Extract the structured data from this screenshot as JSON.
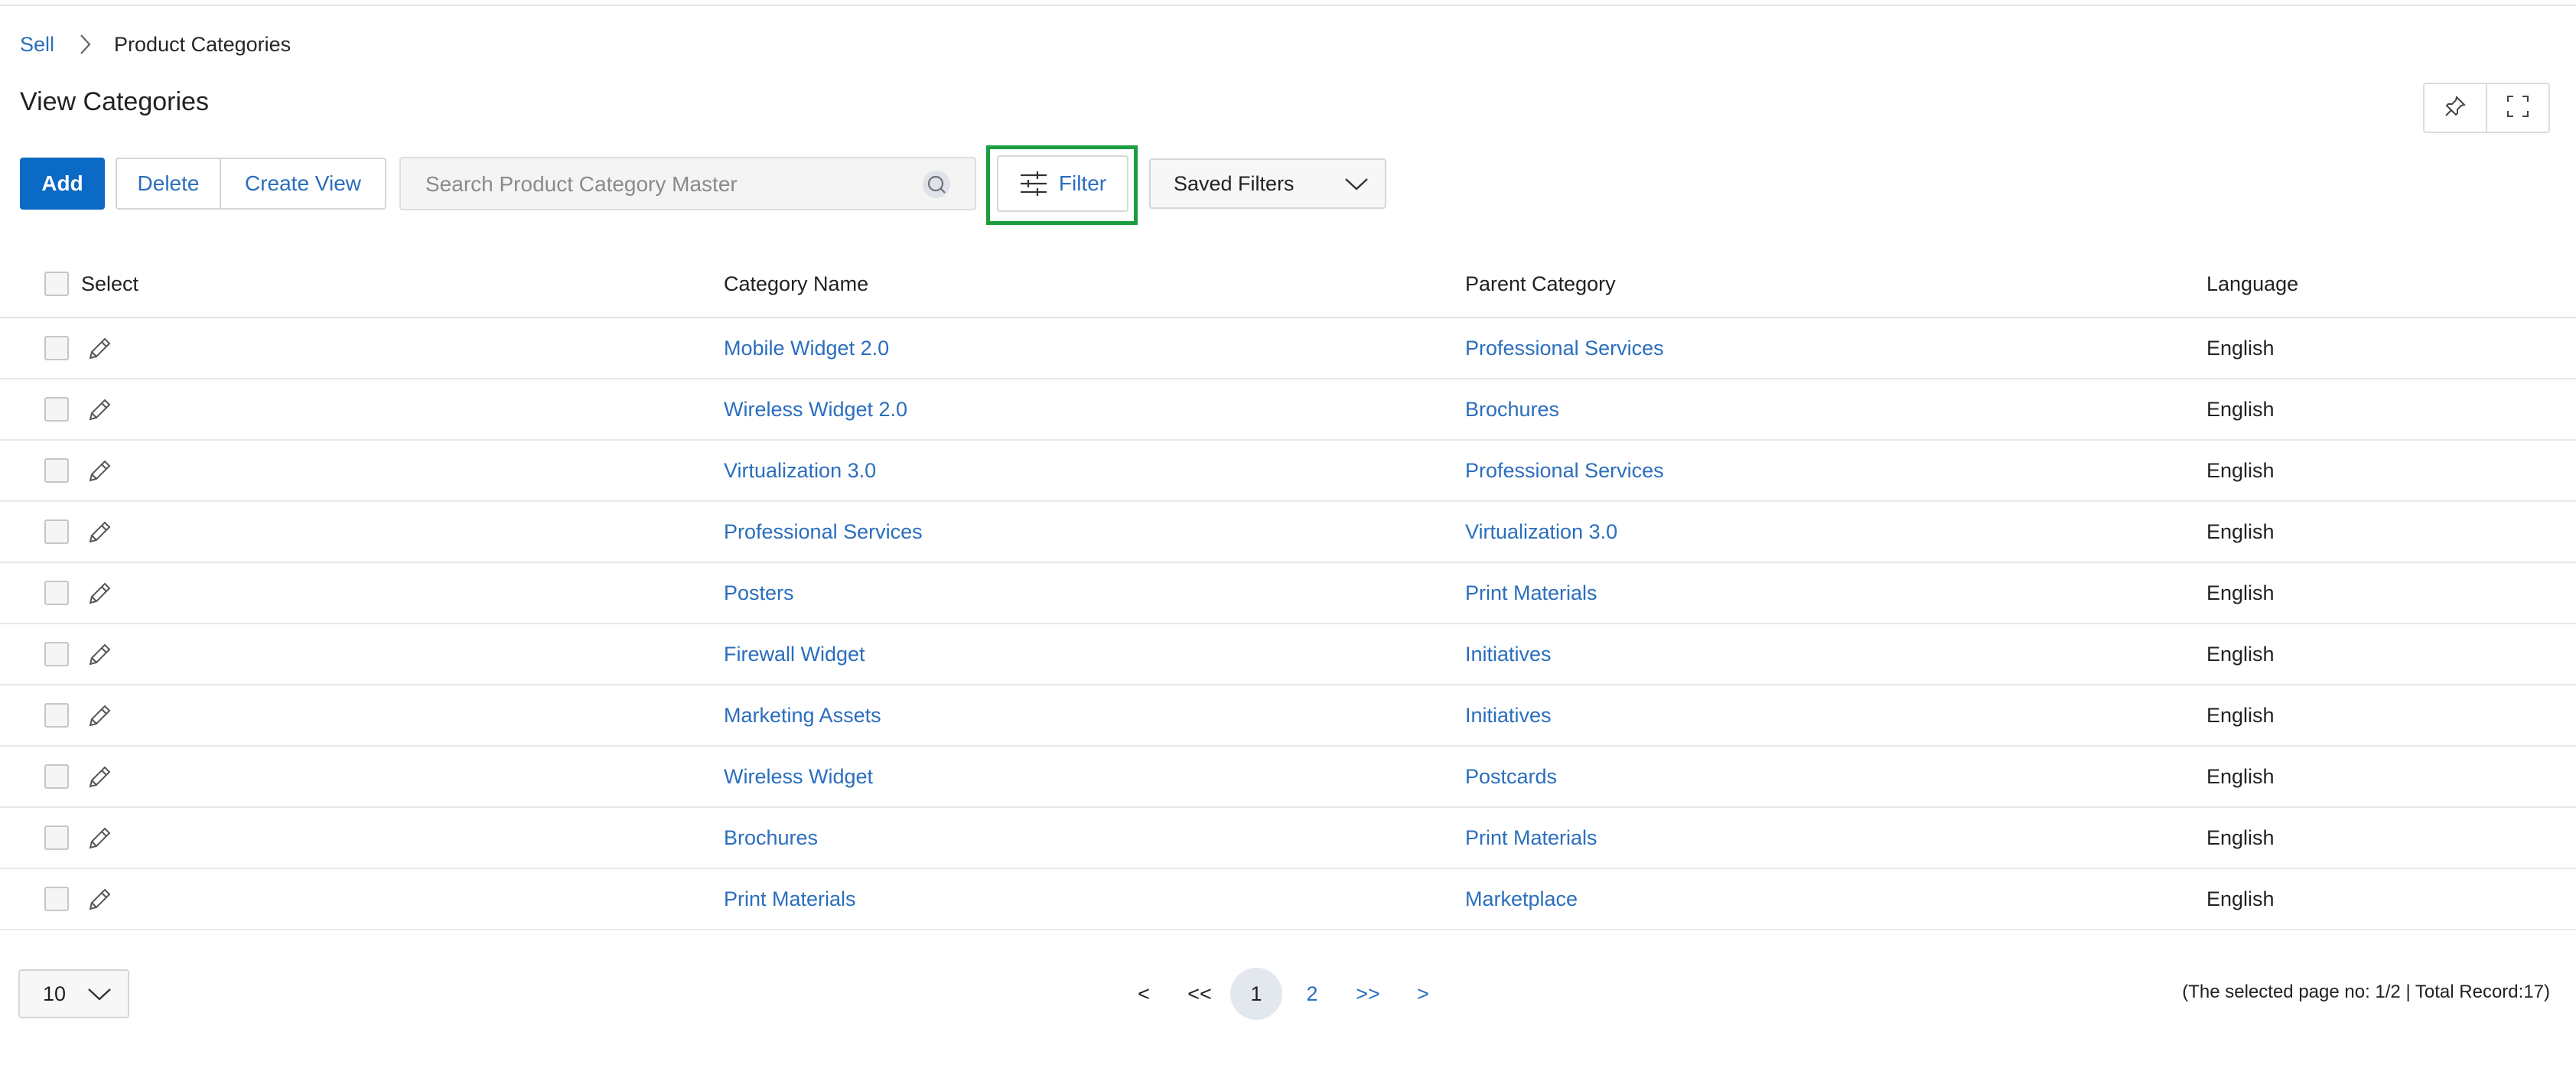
{
  "breadcrumb": {
    "root": "Sell",
    "current": "Product Categories"
  },
  "page": {
    "title": "View Categories"
  },
  "toolbar": {
    "add_label": "Add",
    "delete_label": "Delete",
    "create_view_label": "Create View",
    "search_placeholder": "Search Product Category Master",
    "search_value": "",
    "filter_label": "Filter",
    "saved_filters_label": "Saved Filters"
  },
  "table": {
    "columns": {
      "select": "Select",
      "category_name": "Category Name",
      "parent_category": "Parent Category",
      "language": "Language"
    },
    "rows": [
      {
        "category_name": "Mobile Widget 2.0",
        "parent_category": "Professional Services",
        "language": "English"
      },
      {
        "category_name": "Wireless Widget 2.0",
        "parent_category": "Brochures",
        "language": "English"
      },
      {
        "category_name": "Virtualization 3.0",
        "parent_category": "Professional Services",
        "language": "English"
      },
      {
        "category_name": "Professional Services",
        "parent_category": "Virtualization 3.0",
        "language": "English"
      },
      {
        "category_name": "Posters",
        "parent_category": "Print Materials",
        "language": "English"
      },
      {
        "category_name": "Firewall Widget",
        "parent_category": "Initiatives",
        "language": "English"
      },
      {
        "category_name": "Marketing Assets",
        "parent_category": "Initiatives",
        "language": "English"
      },
      {
        "category_name": "Wireless Widget",
        "parent_category": "Postcards",
        "language": "English"
      },
      {
        "category_name": "Brochures",
        "parent_category": "Print Materials",
        "language": "English"
      },
      {
        "category_name": "Print Materials",
        "parent_category": "Marketplace",
        "language": "English"
      }
    ]
  },
  "pagination": {
    "page_size": "10",
    "prev": "<",
    "first": "<<",
    "pages": [
      "1",
      "2"
    ],
    "current_page": "1",
    "last": ">>",
    "next": ">",
    "status": "(The selected page no: 1/2 | Total Record:17)"
  },
  "colors": {
    "primary": "#0a6ac6",
    "link": "#2a6ebd",
    "highlight_outline": "#1d9c41"
  },
  "icons": [
    "chevron-right-icon",
    "pin-icon",
    "fullscreen-icon",
    "search-icon",
    "filter-sliders-icon",
    "chevron-down-icon",
    "pencil-icon"
  ]
}
